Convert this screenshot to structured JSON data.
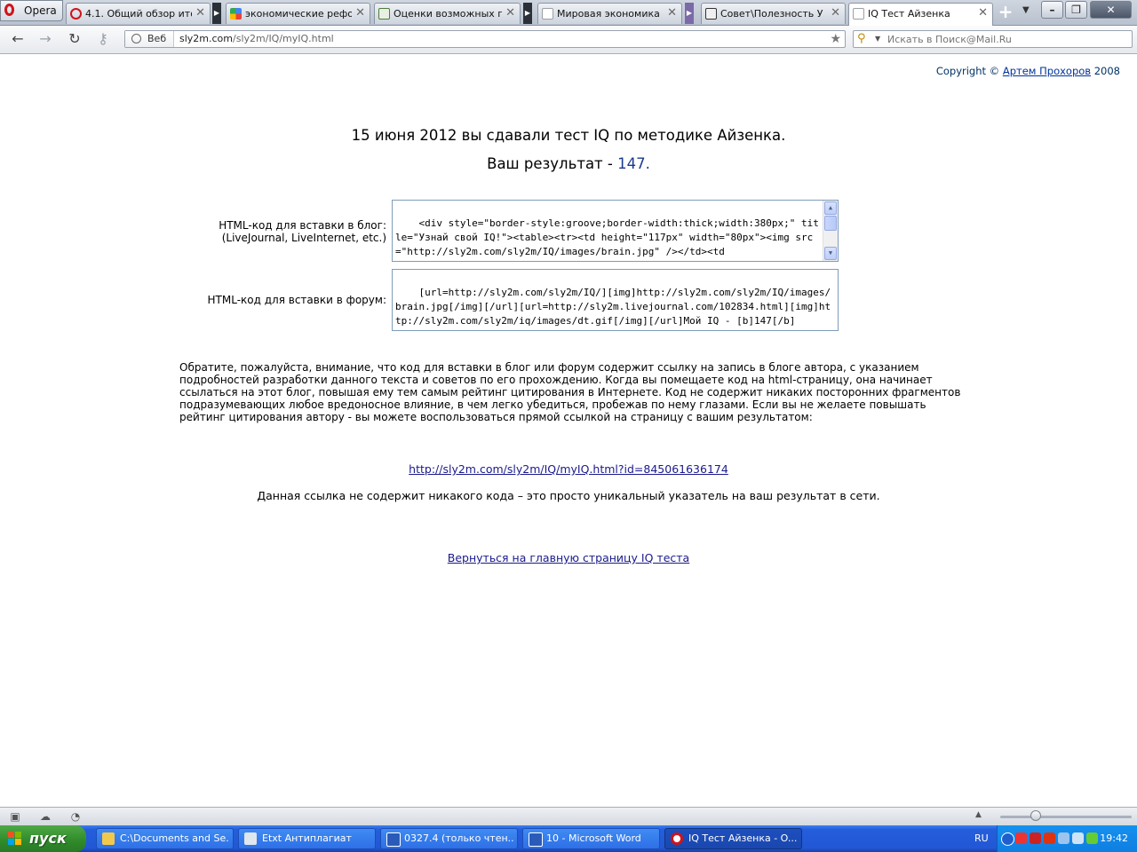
{
  "browser": {
    "menu_label": "Opera",
    "tabs": [
      {
        "title": "4.1. Общий обзор ито...",
        "favicon_color": "#d0141a"
      },
      {
        "title": "экономические рефор...",
        "favicon_color": "#3c8a2e"
      },
      {
        "title": "Оценки возможных п...",
        "favicon_color": "#4a7f3a"
      },
      {
        "title": "Мировая экономика : ...",
        "favicon_color": "#b0b6bf"
      },
      {
        "title": "Совет\\Полезность У ...",
        "favicon_color": "#333333"
      },
      {
        "title": "IQ Тест Айзенка",
        "favicon_color": "#b0b6bf"
      }
    ],
    "active_tab_index": 5,
    "address": {
      "web_label": "Веб",
      "host": "sly2m.com",
      "path": "/sly2m/IQ/myIQ.html"
    },
    "search": {
      "placeholder": "Искать в Поиск@Mail.Ru"
    }
  },
  "page": {
    "copyright": {
      "prefix": "Copyright ©",
      "author": "Артем Прохоров",
      "year": "2008"
    },
    "headline": "15 июня 2012 вы сдавали тест IQ по методике Айзенка.",
    "result": {
      "prefix": "Ваш результат -",
      "value": "147",
      "suffix": "."
    },
    "blog_code": {
      "label_line1": "HTML-код для вставки в блог:",
      "label_line2": "(LiveJournal, LiveInternet, etc.)",
      "code": "<div style=\"border-style:groove;border-width:thick;width:380px;\" title=\"Узнай свой IQ!\"><table><tr><td height=\"117px\" width=\"80px\"><img src=\"http://sly2m.com/sly2m/IQ/images/brain.jpg\" /></td><td"
    },
    "forum_code": {
      "label": "HTML-код для вставки в форум:",
      "code": "[url=http://sly2m.com/sly2m/IQ/][img]http://sly2m.com/sly2m/IQ/images/brain.jpg[/img][/url][url=http://sly2m.livejournal.com/102834.html][img]http://sly2m.com/sly2m/iq/images/dt.gif[/img][/url]Мой IQ - [b]147[/b]"
    },
    "notice": "Обратите, пожалуйста, внимание, что код для вставки в блог или форум содержит ссылку на запись в блоге автора, с указанием подробностей разработки данного текста и советов по его прохождению. Когда вы помещаете код на html-страницу, она начинает ссылаться на этот блог, повышая ему тем самым рейтинг цитирования в Интернете. Код не содержит никаких посторонних фрагментов подразумевающих любое вредоносное влияние, в чем легко убедиться, пробежав по нему глазами. Если вы не желаете повышать рейтинг цитирования автору - вы можете воспользоваться прямой ссылкой на страницу с вашим результатом:",
    "direct_link": "http://sly2m.com/sly2m/IQ/myIQ.html?id=845061636174",
    "link_note": "Данная ссылка не содержит никакого кода – это просто уникальный указатель на ваш результат в сети.",
    "back_link": "Вернуться на главную страницу IQ теста"
  },
  "taskbar": {
    "start_label": "пуск",
    "items": [
      {
        "label": "C:\\Documents and Se...",
        "icon_color": "#f2c94c"
      },
      {
        "label": "Etxt Антиплагиат",
        "icon_color": "#dfe6ee"
      },
      {
        "label": "0327.4 (только чтен...",
        "icon_color": "#2b5bb8"
      },
      {
        "label": "10 - Microsoft Word",
        "icon_color": "#2b5bb8"
      },
      {
        "label": "IQ Тест Айзенка - O...",
        "icon_color": "#d0141a"
      }
    ],
    "language": "RU",
    "clock": "19:42"
  }
}
